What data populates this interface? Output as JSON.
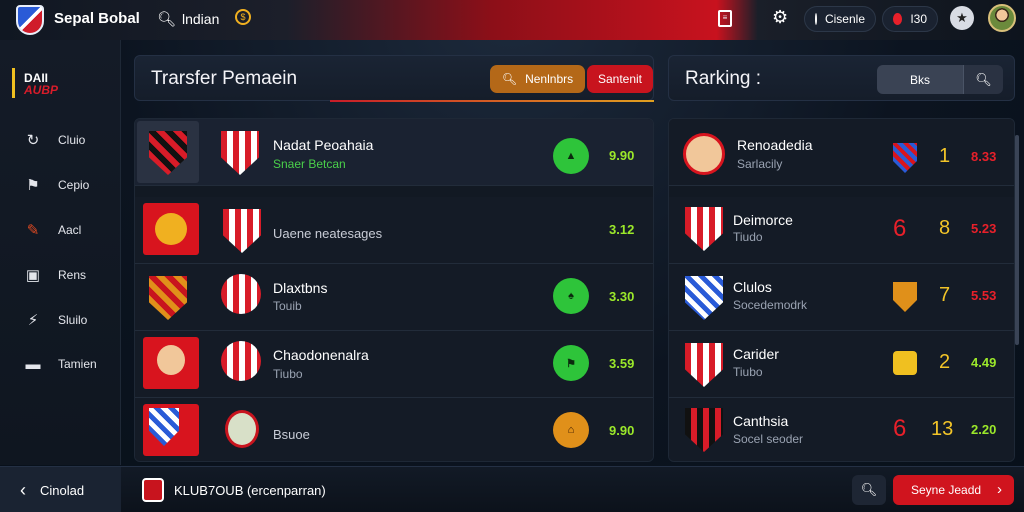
{
  "topbar": {
    "app_title": "Sepal Bobal",
    "search_text": "lndian",
    "pill1_text": "Cisenle",
    "pill2_text": "I30"
  },
  "sidebar": {
    "brand_line1": "DAII",
    "brand_line2": "AUBP",
    "items": [
      {
        "label": "Cluio",
        "icon": "refresh-icon"
      },
      {
        "label": "Cepio",
        "icon": "flag-icon"
      },
      {
        "label": "Aacl",
        "icon": "edit-icon"
      },
      {
        "label": "Rens",
        "icon": "chart-icon"
      },
      {
        "label": "Sluilo",
        "icon": "bolt-icon"
      },
      {
        "label": "Tamien",
        "icon": "chat-icon"
      }
    ]
  },
  "transfer": {
    "title": "Trarsfer Pemaein",
    "btn_primary": "Nenlnbrs",
    "btn_secondary": "Santenit",
    "rows": [
      {
        "name": "Nadat Peoahaia",
        "sub": "Snaer  Betcan",
        "badge": "",
        "value": "9.90"
      },
      {
        "name": "",
        "sub": "Uaene neatesages",
        "badge": "",
        "value": "3.12"
      },
      {
        "name": "Dlaxtbns",
        "sub": "Touib",
        "badge": "",
        "value": "3.30"
      },
      {
        "name": "Chaodonenalra",
        "sub": "Tiubo",
        "badge": "",
        "value": "3.59"
      },
      {
        "name": "",
        "sub": "Bsuoe",
        "badge": "",
        "value": "9.90"
      }
    ]
  },
  "ranking": {
    "title": "Rarking :",
    "filter": "Bks",
    "rows": [
      {
        "name": "Renoadedia",
        "sub": "Sarlacily",
        "num1": "",
        "num2": "1",
        "pct": "8.33"
      },
      {
        "name": "Deimorce",
        "sub": "Tiudo",
        "num1": "6",
        "num2": "8",
        "pct": "5.23"
      },
      {
        "name": "Clulos",
        "sub": "Socedemodrk",
        "num1": "",
        "num2": "7",
        "pct": "5.53"
      },
      {
        "name": "Carider",
        "sub": "Tiubo",
        "num1": "",
        "num2": "2",
        "pct": "4.49"
      },
      {
        "name": "Canthsia",
        "sub": "Socel seoder",
        "num1": "6",
        "num2": "13",
        "pct": "2.20"
      }
    ]
  },
  "bottombar": {
    "back_label": "Cinolad",
    "club_text": "KLUB7OUB (ercenparran)",
    "cta_label": "Seyne Jeadd"
  }
}
